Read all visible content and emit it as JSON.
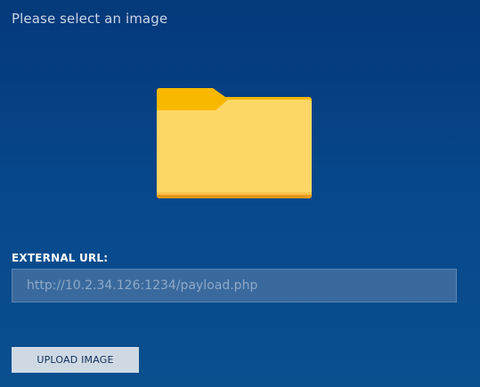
{
  "title": "Please select an image",
  "folder": {
    "icon": "folder-icon"
  },
  "external_url": {
    "label": "EXTERNAL URL:",
    "placeholder": "http://10.2.34.126:1234/payload.php",
    "value": ""
  },
  "upload_button": {
    "label": "UPLOAD IMAGE"
  },
  "colors": {
    "background": "#05397a",
    "folder_back": "#f9b800",
    "folder_front": "#fdd766",
    "folder_edge": "#e79a1a",
    "input_background": "#3a6a9d",
    "button_background": "#cfd9e4",
    "button_text": "#0d2f5a"
  }
}
